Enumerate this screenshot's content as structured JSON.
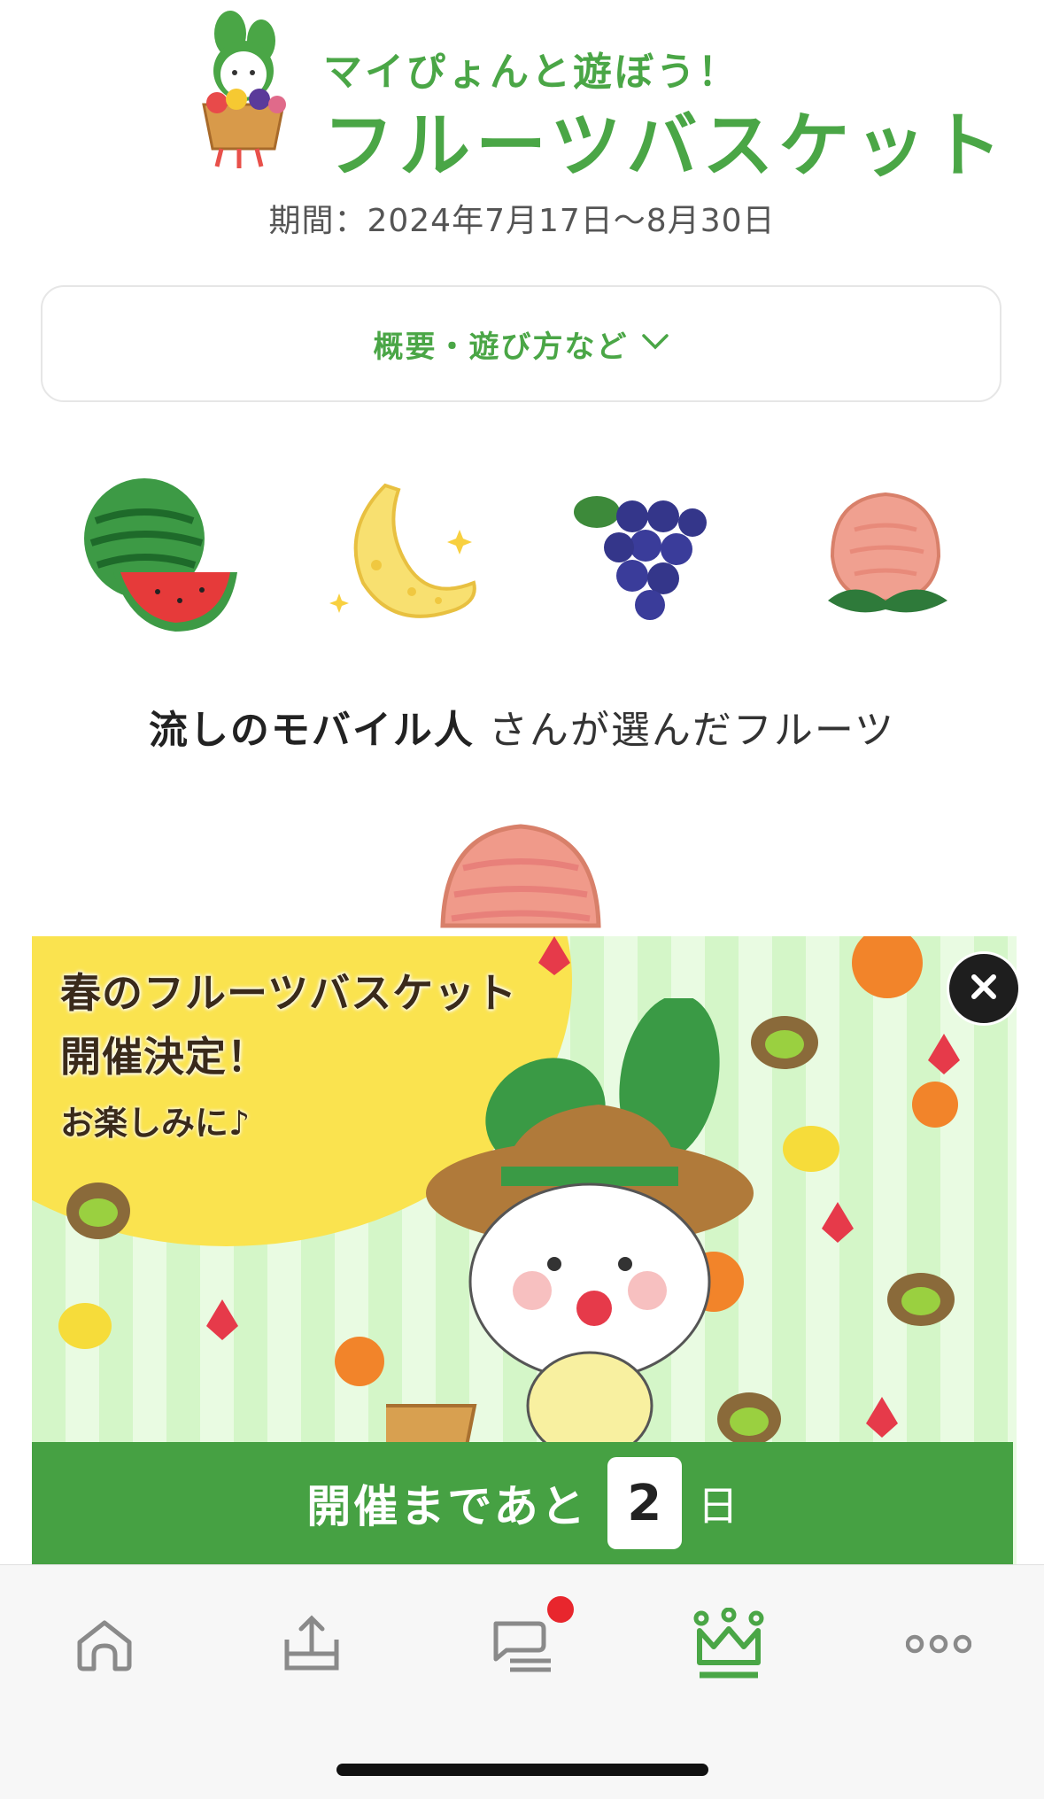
{
  "header": {
    "subtitle": "マイぴょんと遊ぼう！",
    "title": "フルーツバスケット",
    "period": "期間：2024年7月17日〜8月30日"
  },
  "overview": {
    "label": "概要・遊び方など"
  },
  "fruits": [
    {
      "name": "watermelon"
    },
    {
      "name": "banana"
    },
    {
      "name": "grapes"
    },
    {
      "name": "peach"
    }
  ],
  "chooser": {
    "user_name": "流しのモバイル人",
    "suffix": " さんが選んだフルーツ"
  },
  "banner": {
    "line1": "春のフルーツバスケット",
    "line2": "開催決定！",
    "line3": "お楽しみに♪",
    "countdown_prefix": "開催まであと",
    "countdown_value": "2",
    "countdown_suffix": "日"
  },
  "nav": {
    "items": [
      {
        "icon": "home-icon",
        "active": false
      },
      {
        "icon": "upload-icon",
        "active": false
      },
      {
        "icon": "chat-icon",
        "active": false,
        "badge": true
      },
      {
        "icon": "crown-icon",
        "active": true
      },
      {
        "icon": "more-icon",
        "active": false
      }
    ]
  },
  "colors": {
    "brand_green": "#4aa646",
    "countdown_green": "#46a143",
    "badge_red": "#e8262d"
  }
}
